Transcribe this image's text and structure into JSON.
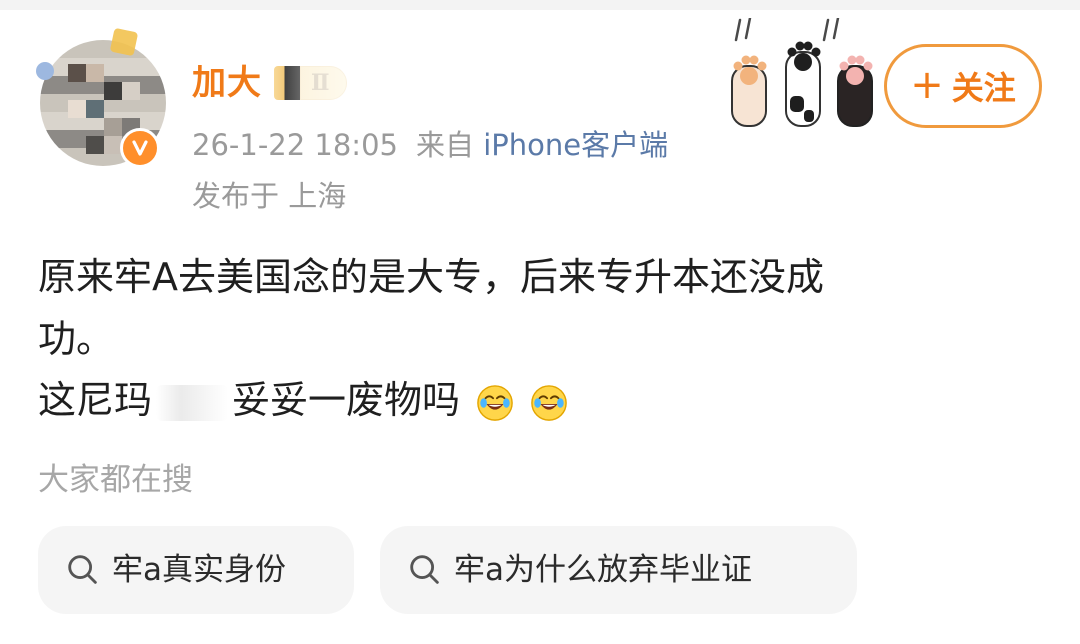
{
  "post": {
    "username": "加大",
    "level_badge": "Ⅱ",
    "timestamp": "26-1-22 18:05",
    "source_prefix": "来自",
    "source": "iPhone客户端",
    "location": "发布于 上海",
    "follow_label": "关注",
    "follow_plus": "+",
    "text_line_1": "原来牢A去美国念的是大专，后来专升本还没成",
    "text_line_2": "功。",
    "text_line_3_a": "这尼玛",
    "text_line_3_b": "妥妥一废物吗"
  },
  "search_section": {
    "heading": "大家都在搜",
    "chips": [
      {
        "label": "牢a真实身份"
      },
      {
        "label": "牢a为什么放弃毕业证"
      }
    ]
  },
  "icons": {
    "verify_badge": "verified-v-icon",
    "search_icon": "search-icon",
    "emoji": "tears-of-joy-emoji-icon",
    "paws": "cat-paw-decoration-icon"
  },
  "colors": {
    "accent": "#f07a18",
    "source_link": "#5b7aa8",
    "meta_gray": "#9a9a9a",
    "chip_bg": "#f5f5f5"
  }
}
